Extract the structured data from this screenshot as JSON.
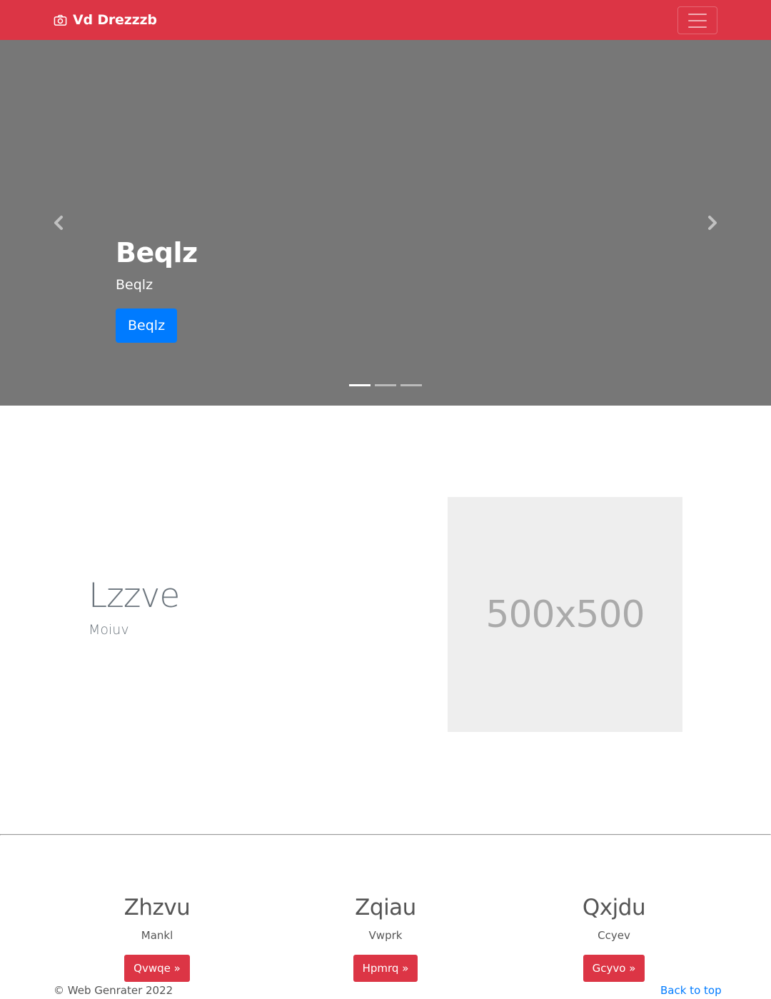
{
  "navbar": {
    "brand": "Vd Drezzzb",
    "brand_icon": "camera-icon",
    "toggler_icon": "hamburger-menu-icon",
    "background_color": "#dc3545"
  },
  "carousel": {
    "background_color": "#777777",
    "title": "Beqlz",
    "text": "Beqlz",
    "button_label": "Beqlz",
    "button_color": "#007bff",
    "prev_icon": "chevron-left-icon",
    "next_icon": "chevron-right-icon",
    "slide_count": 3,
    "active_slide": 1
  },
  "feature": {
    "heading": "Lzzve",
    "lead": "Moiuv",
    "image_label": "500x500"
  },
  "columns": [
    {
      "title": "Zhzvu",
      "text": "Mankl",
      "button_label": "Qvwqe »"
    },
    {
      "title": "Zqiau",
      "text": "Vwprk",
      "button_label": "Hpmrq »"
    },
    {
      "title": "Qxjdu",
      "text": "Ccyev",
      "button_label": "Gcyvo »"
    }
  ],
  "footer": {
    "copyright": "© Web Genrater 2022",
    "back_to_top": "Back to top"
  }
}
